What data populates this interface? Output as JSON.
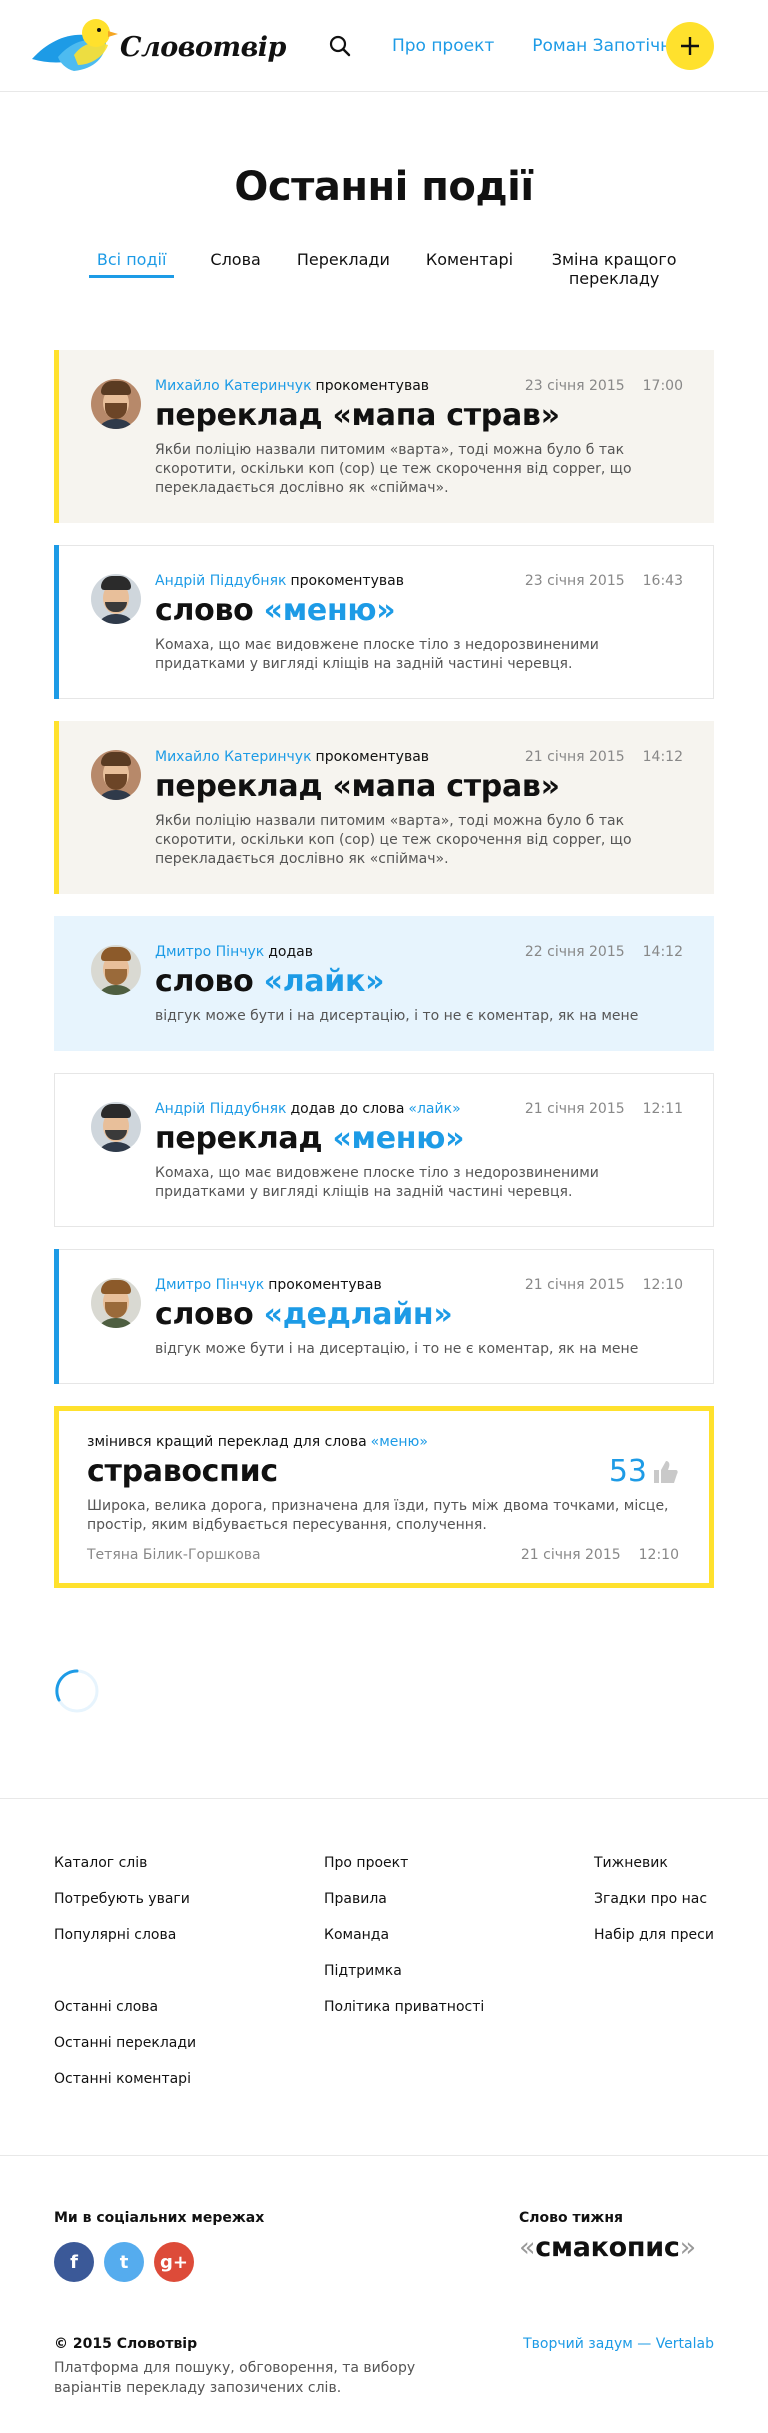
{
  "header": {
    "logo_text": "Словотвір",
    "nav": [
      "Про проект",
      "Роман Запотічний"
    ],
    "add_label": "+"
  },
  "page_title": "Останні події",
  "tabs": [
    "Всі події",
    "Слова",
    "Переклади",
    "Коментарі",
    "Зміна кращого перекладу"
  ],
  "feed": [
    {
      "author": "Михайло Катеринчук",
      "action": "прокоментував",
      "tag": "",
      "date": "23 січня 2015",
      "time": "17:00",
      "prefix": "переклад ",
      "highlight": "«мапа страв»",
      "text": "Якби поліцію назвали питомим «варта», тоді можна було б так скоротити, оскільки коп (cop) це теж скорочення від copper, що перекладається дослівно як «спіймач»."
    },
    {
      "author": "Андрій Піддубняк",
      "action": "прокоментував",
      "tag": "",
      "date": "23 січня 2015",
      "time": "16:43",
      "prefix": "слово ",
      "highlight": "«меню»",
      "text": "Комаха, що має видовжене плоске тіло з недорозвиненими придатками у вигляді кліщів на задній частині черевця."
    },
    {
      "author": "Михайло Катеринчук",
      "action": "прокоментував",
      "tag": "",
      "date": "21 січня 2015",
      "time": "14:12",
      "prefix": "переклад ",
      "highlight": "«мапа страв»",
      "text": "Якби поліцію назвали питомим «варта», тоді можна було б так скоротити, оскільки коп (cop) це теж скорочення від copper, що перекладається дослівно як «спіймач»."
    },
    {
      "author": "Дмитро Пінчук",
      "action": "додав",
      "tag": "",
      "date": "22 січня 2015",
      "time": "14:12",
      "prefix": "слово ",
      "highlight": "«лайк»",
      "text": "відгук може бути і на дисертацію, і то не є коментар, як на мене"
    },
    {
      "author": "Андрій Піддубняк",
      "action": "додав до слова",
      "tag": "«лайк»",
      "date": "21 січня 2015",
      "time": "12:11",
      "prefix": "переклад ",
      "highlight": "«меню»",
      "text": "Комаха, що має видовжене плоске тіло з недорозвиненими придатками у вигляді кліщів на задній частині черевця."
    },
    {
      "author": "Дмитро Пінчук",
      "action": "прокоментував",
      "tag": "",
      "date": "21 січня 2015",
      "time": "12:10",
      "prefix": "слово ",
      "highlight": "«дедлайн»",
      "text": "відгук може бути і на дисертацію, і то не є коментар, як на мене"
    }
  ],
  "best": {
    "label": "змінився кращий переклад для слова",
    "word": "«меню»",
    "title": "стравоспис",
    "votes": "53",
    "text": "Широка, велика дорога, призначена для їзди, путь між двома точками, місце, простір, яким відбувається пересування, сполучення.",
    "author": "Тетяна Білик-Горшкова",
    "date": "21 січня 2015",
    "time": "12:10"
  },
  "footer": {
    "col1": [
      "Каталог слів",
      "Потребують уваги",
      "Популярні слова"
    ],
    "col1b": [
      "Останні слова",
      "Останні переклади",
      "Останні коментарі"
    ],
    "col2": [
      "Про проект",
      "Правила",
      "Команда",
      "Підтримка",
      "Політика приватності"
    ],
    "col3": [
      "Тижневик",
      "Згадки про нас",
      "Набір для преси"
    ],
    "social_title": "Ми в соціальних мережах",
    "social": [
      "f",
      "t",
      "g+"
    ],
    "word_week_label": "Слово тижня",
    "word_week_open": "«",
    "word_week": "смакопис",
    "word_week_close": "»",
    "copyright": "© 2015 Словотвір",
    "description": "Платформа для пошуку, обговорення, та вибору варіантів перекладу запозичених слів.",
    "credit": "Творчий задум — Vertalab"
  },
  "colors": {
    "accent": "#1d9be6",
    "yellow": "#ffe12d",
    "beige": "#f6f4ef",
    "light_blue": "#e7f4fd"
  }
}
